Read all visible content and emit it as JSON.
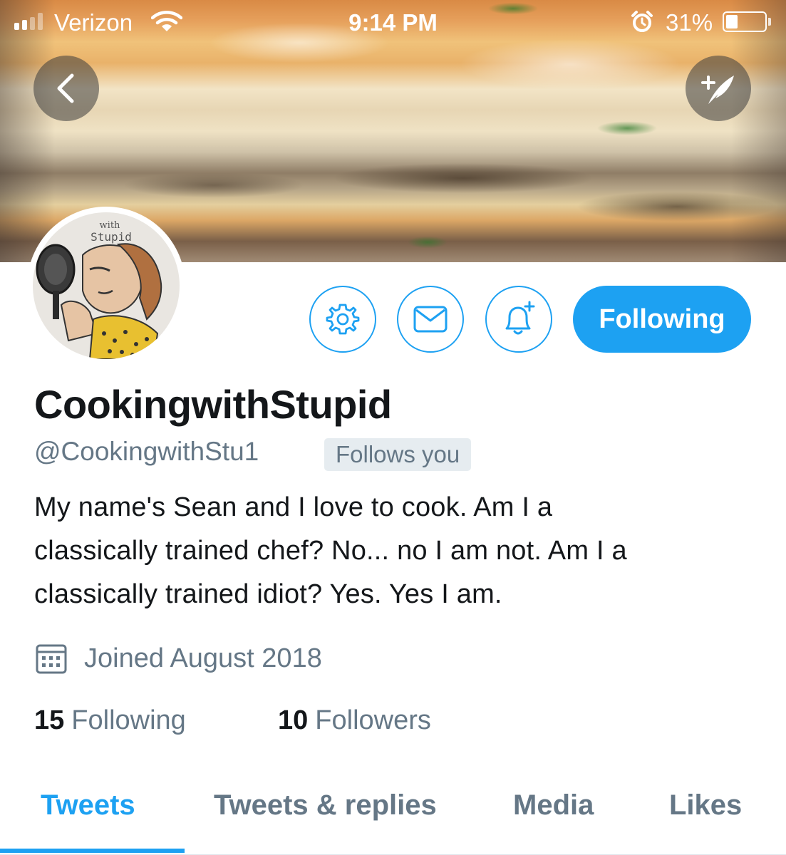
{
  "status_bar": {
    "carrier": "Verizon",
    "time": "9:14 PM",
    "battery_percent": "31%",
    "battery_level": 0.31,
    "icons": [
      "signal-icon",
      "wifi-icon",
      "alarm-icon",
      "battery-icon"
    ]
  },
  "header": {
    "back_icon": "chevron-left-icon",
    "compose_icon": "compose-tweet-icon"
  },
  "avatar": {
    "text_line1": "with",
    "text_line2": "Stupid"
  },
  "actions": {
    "settings_icon": "gear-icon",
    "message_icon": "envelope-icon",
    "notify_icon": "bell-plus-icon",
    "follow_label": "Following"
  },
  "profile": {
    "display_name": "CookingwithStupid",
    "handle": "@CookingwithStu1",
    "follows_you": "Follows you",
    "bio_line1": "My name's Sean and I love to cook. Am I a",
    "bio_line2": "classically trained chef? No... no I am not. Am I a",
    "bio_line3": "classically trained idiot? Yes. Yes I am.",
    "joined": "Joined August 2018"
  },
  "stats": {
    "following_count": "15",
    "following_label": "Following",
    "followers_count": "10",
    "followers_label": "Followers"
  },
  "tabs": [
    {
      "label": "Tweets",
      "active": true
    },
    {
      "label": "Tweets & replies",
      "active": false
    },
    {
      "label": "Media",
      "active": false
    },
    {
      "label": "Likes",
      "active": false
    }
  ],
  "colors": {
    "accent": "#1da1f2",
    "secondary_text": "#657786",
    "primary_text": "#14171a"
  }
}
